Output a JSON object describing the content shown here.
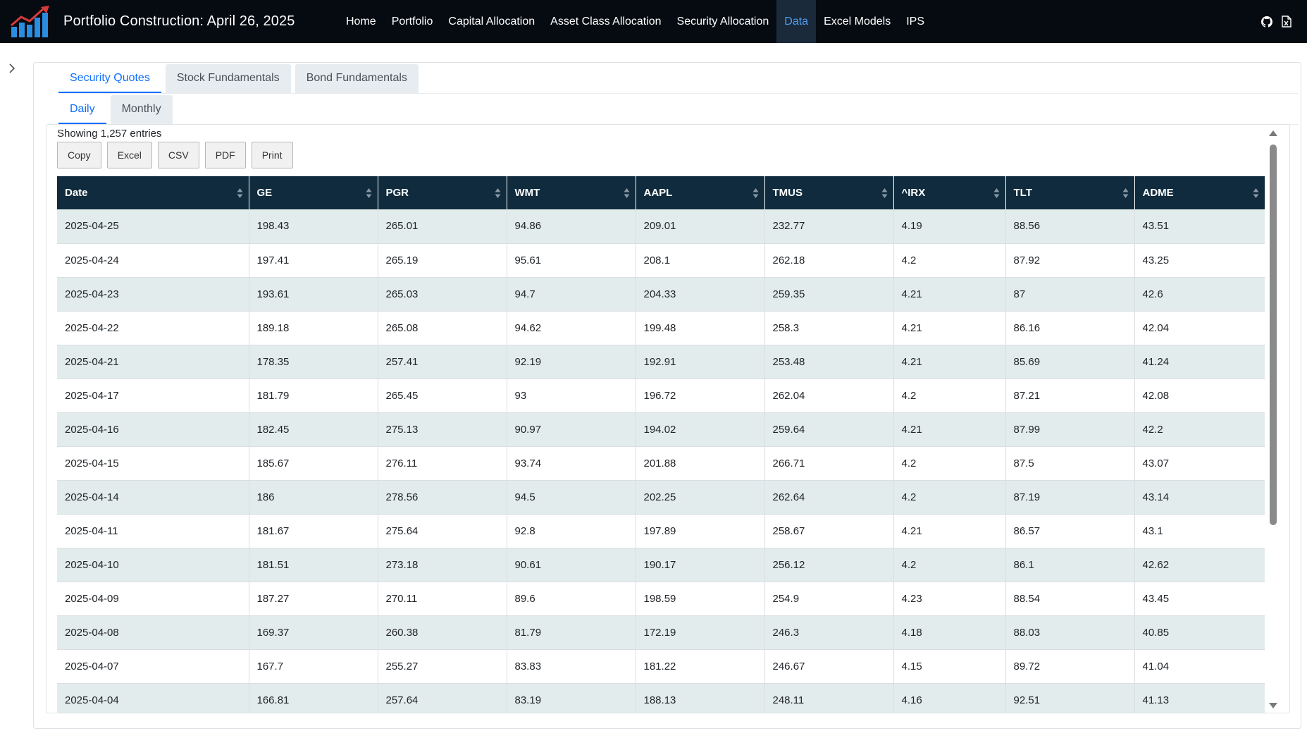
{
  "navbar": {
    "title": "Portfolio Construction: April 26, 2025",
    "links": [
      {
        "label": "Home"
      },
      {
        "label": "Portfolio"
      },
      {
        "label": "Capital Allocation"
      },
      {
        "label": "Asset Class Allocation"
      },
      {
        "label": "Security Allocation"
      },
      {
        "label": "Data"
      },
      {
        "label": "Excel Models"
      },
      {
        "label": "IPS"
      }
    ],
    "active_link": "Data",
    "icons": [
      "github-icon",
      "excel-file-icon"
    ],
    "logo_icon": "bar-chart-growth-icon",
    "accent_color": "#4f9ff0"
  },
  "tabs": [
    {
      "label": "Security Quotes"
    },
    {
      "label": "Stock Fundamentals"
    },
    {
      "label": "Bond Fundamentals"
    }
  ],
  "subtabs": [
    {
      "label": "Daily"
    },
    {
      "label": "Monthly"
    }
  ],
  "table_panel": {
    "entries_info": "Showing 1,257 entries",
    "buttons": [
      {
        "label": "Copy"
      },
      {
        "label": "Excel"
      },
      {
        "label": "CSV"
      },
      {
        "label": "PDF"
      },
      {
        "label": "Print"
      }
    ],
    "columns": [
      "Date",
      "GE",
      "PGR",
      "WMT",
      "AAPL",
      "TMUS",
      "^IRX",
      "TLT",
      "ADME"
    ],
    "rows": [
      [
        "2025-04-25",
        "198.43",
        "265.01",
        "94.86",
        "209.01",
        "232.77",
        "4.19",
        "88.56",
        "43.51"
      ],
      [
        "2025-04-24",
        "197.41",
        "265.19",
        "95.61",
        "208.1",
        "262.18",
        "4.2",
        "87.92",
        "43.25"
      ],
      [
        "2025-04-23",
        "193.61",
        "265.03",
        "94.7",
        "204.33",
        "259.35",
        "4.21",
        "87",
        "42.6"
      ],
      [
        "2025-04-22",
        "189.18",
        "265.08",
        "94.62",
        "199.48",
        "258.3",
        "4.21",
        "86.16",
        "42.04"
      ],
      [
        "2025-04-21",
        "178.35",
        "257.41",
        "92.19",
        "192.91",
        "253.48",
        "4.21",
        "85.69",
        "41.24"
      ],
      [
        "2025-04-17",
        "181.79",
        "265.45",
        "93",
        "196.72",
        "262.04",
        "4.2",
        "87.21",
        "42.08"
      ],
      [
        "2025-04-16",
        "182.45",
        "275.13",
        "90.97",
        "194.02",
        "259.64",
        "4.21",
        "87.99",
        "42.2"
      ],
      [
        "2025-04-15",
        "185.67",
        "276.11",
        "93.74",
        "201.88",
        "266.71",
        "4.2",
        "87.5",
        "43.07"
      ],
      [
        "2025-04-14",
        "186",
        "278.56",
        "94.5",
        "202.25",
        "262.64",
        "4.2",
        "87.19",
        "43.14"
      ],
      [
        "2025-04-11",
        "181.67",
        "275.64",
        "92.8",
        "197.89",
        "258.67",
        "4.21",
        "86.57",
        "43.1"
      ],
      [
        "2025-04-10",
        "181.51",
        "273.18",
        "90.61",
        "190.17",
        "256.12",
        "4.2",
        "86.1",
        "42.62"
      ],
      [
        "2025-04-09",
        "187.27",
        "270.11",
        "89.6",
        "198.59",
        "254.9",
        "4.23",
        "88.54",
        "43.45"
      ],
      [
        "2025-04-08",
        "169.37",
        "260.38",
        "81.79",
        "172.19",
        "246.3",
        "4.18",
        "88.03",
        "40.85"
      ],
      [
        "2025-04-07",
        "167.7",
        "255.27",
        "83.83",
        "181.22",
        "246.67",
        "4.15",
        "89.72",
        "41.04"
      ],
      [
        "2025-04-04",
        "166.81",
        "257.64",
        "83.19",
        "188.13",
        "248.11",
        "4.16",
        "92.51",
        "41.13"
      ]
    ],
    "header_color": "#0f2b3d",
    "stripe_color": "#e3ecec"
  }
}
